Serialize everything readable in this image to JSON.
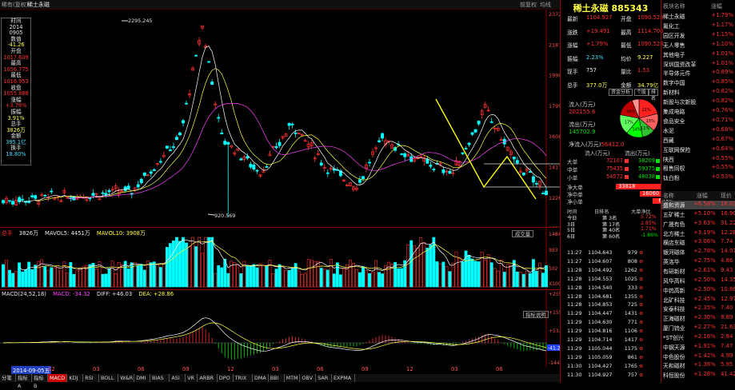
{
  "titlebar": {
    "left": "稀有(复权)",
    "stock": "稀土永磁",
    "right": "前复权",
    "indicator": "均线"
  },
  "infobox": [
    {
      "t": "时间",
      "c": "wht"
    },
    {
      "t": "2014",
      "c": "wht"
    },
    {
      "t": "0905",
      "c": "wht"
    },
    {
      "t": "数值",
      "c": "wht"
    },
    {
      "t": "-41.26",
      "c": "yel"
    },
    {
      "t": "开盘",
      "c": "wht"
    },
    {
      "t": "1017.609",
      "c": "red"
    },
    {
      "t": "最高",
      "c": "wht"
    },
    {
      "t": "1056.775",
      "c": "red"
    },
    {
      "t": "最低",
      "c": "wht"
    },
    {
      "t": "1016.953",
      "c": "red"
    },
    {
      "t": "收盘",
      "c": "wht"
    },
    {
      "t": "1055.888",
      "c": "red"
    },
    {
      "t": "涨幅",
      "c": "wht"
    },
    {
      "t": "+3.79%",
      "c": "red"
    },
    {
      "t": "振幅",
      "c": "wht"
    },
    {
      "t": "3.91%",
      "c": "yel"
    },
    {
      "t": "总手",
      "c": "wht"
    },
    {
      "t": "3826万",
      "c": "yel"
    },
    {
      "t": "金额",
      "c": "wht"
    },
    {
      "t": "395.1亿",
      "c": "cyn"
    },
    {
      "t": "换手",
      "c": "wht"
    },
    {
      "t": "18.80%",
      "c": "cyn"
    }
  ],
  "price_axis": [
    "2372",
    "2181",
    "1990",
    "1799",
    "1608",
    "1417",
    "1226",
    "1035"
  ],
  "annotations": {
    "high": "2295.245",
    "low": "920.569"
  },
  "volume": {
    "label": "总手",
    "total": "3826万",
    "ma5": "MAVOL5: 4451万",
    "ma10": "MAVOL10: 3908万",
    "axis": [
      "1484",
      "993",
      "502",
      "X100000"
    ],
    "btn": "成交量"
  },
  "macd": {
    "label": "MACD(24,52,18)",
    "macd": "MACD: -34.32",
    "diff": "DIFF: +46.03",
    "dea": "DEA: +28.86",
    "axis": [
      "+255.9",
      "+155.8",
      "+53.88",
      "-48.13",
      "-144.2"
    ],
    "badge": "-41.26",
    "btn": "指标说明"
  },
  "xaxis": [
    "2014-09-05五",
    "12",
    "03",
    "06",
    "09",
    "12",
    "03",
    "06",
    "09",
    "12",
    "03",
    "06"
  ],
  "tabs": [
    "分笔",
    "指标A",
    "指标B",
    "MACD",
    "KDJ",
    "RSI",
    "BOLL",
    "W&R",
    "DMI",
    "BIAS",
    "ASI",
    "VR",
    "ARBR",
    "DPO",
    "TRIX",
    "DMA",
    "BBI",
    "MTM",
    "OBV",
    "SAR",
    "EXPMA"
  ],
  "quote": {
    "title": "稀土永磁 885343",
    "rows": [
      {
        "l1": "最新",
        "v1": "1104.927",
        "c1": "red",
        "l2": "开盘",
        "v2": "1090.528",
        "c2": "red"
      },
      {
        "l1": "涨跌",
        "v1": "+19.491",
        "c1": "red",
        "l2": "最高",
        "v2": "1114.700",
        "c2": "red"
      },
      {
        "l1": "涨幅",
        "v1": "+1.79%",
        "c1": "red",
        "l2": "最低",
        "v2": "1090.528",
        "c2": "red"
      },
      {
        "l1": "振幅",
        "v1": "2.23%",
        "c1": "cyn",
        "l2": "均价",
        "v2": "9.227",
        "c2": "yel"
      },
      {
        "l1": "现手",
        "v1": "757",
        "c1": "wht",
        "l2": "量比",
        "v2": "1.53",
        "c2": "red"
      },
      {
        "l1": "总手",
        "v1": "377.0万",
        "c1": "yel",
        "l2": "金额",
        "v2": "34.79亿",
        "c2": "yel"
      }
    ],
    "btn_flow": "资金分析",
    "btn_up": "个股",
    "btn_rank": "排名",
    "inflow_label": "流入(万元)",
    "inflow": "202155.6",
    "outflow_label": "流出(万元)",
    "outflow": "145702.9",
    "pie": [
      {
        "v": 21,
        "c": "#ff2020"
      },
      {
        "v": 15,
        "c": "#ff6060"
      },
      {
        "v": 11,
        "c": "#30c030"
      },
      {
        "v": 14,
        "c": "#00ff00"
      },
      {
        "v": 17,
        "c": "#60ff60"
      },
      {
        "v": 16,
        "c": "#c00000"
      },
      {
        "v": 6,
        "c": "#ff9090"
      }
    ],
    "pie_labels": [
      "21%",
      "15%",
      "11%",
      "14%",
      "17%",
      "16%"
    ],
    "net_label": "净流入(万元)",
    "net": "56412.0",
    "flow_head": [
      "流入(万元)",
      "流出(万元)"
    ],
    "flow": [
      {
        "k": "大单",
        "in": "72107",
        "out": "38209"
      },
      {
        "k": "中单",
        "in": "75435",
        "out": "59375"
      },
      {
        "k": "小单",
        "in": "54572",
        "out": "48038"
      }
    ],
    "net_flow": [
      {
        "k": "净大单",
        "v": "33818",
        "w": 0.63
      },
      {
        "k": "净中单",
        "v": "16060",
        "w": 0.3
      },
      {
        "k": "净小单",
        "v": "6534",
        "w": 0.12
      }
    ],
    "hist_head": [
      "时间",
      "日排名",
      "大单净比"
    ],
    "hist": [
      {
        "t": "今日",
        "r": "第 3名",
        "v": "5.72%",
        "c": "red"
      },
      {
        "t": "3日",
        "r": "第 17名",
        "v": "2.85%",
        "c": "red"
      },
      {
        "t": "5日",
        "r": "第 40名",
        "v": "1.71%",
        "c": "red"
      },
      {
        "t": "6日",
        "r": "第 60名",
        "v": "-1.86%",
        "c": "grn"
      }
    ],
    "trades": [
      [
        "11:27",
        "1104.643",
        "979",
        "red"
      ],
      [
        "11:27",
        "1104.607",
        "808",
        "red"
      ],
      [
        "11:28",
        "1104.492",
        "1262",
        "red"
      ],
      [
        "11:28",
        "1104.553",
        "1025",
        "red"
      ],
      [
        "11:28",
        "1104.540",
        "333",
        "red"
      ],
      [
        "11:28",
        "1104.681",
        "1355",
        "red"
      ],
      [
        "11:28",
        "1104.853",
        "725",
        "red"
      ],
      [
        "11:29",
        "1104.447",
        "1431",
        "red"
      ],
      [
        "11:29",
        "1104.630",
        "771",
        "red"
      ],
      [
        "11:29",
        "1104.816",
        "1106",
        "red"
      ],
      [
        "11:29",
        "1104.714",
        "1417",
        "red"
      ],
      [
        "11:29",
        "1105.044",
        "1175",
        "red"
      ],
      [
        "11:29",
        "1105.059",
        "861",
        "red"
      ],
      [
        "11:30",
        "1104.427",
        "1765",
        "red"
      ],
      [
        "11:30",
        "1104.927",
        "757",
        "red"
      ]
    ]
  },
  "sectors_top": {
    "head": [
      "板块名称",
      "涨幅"
    ],
    "rows": [
      [
        "稀土永磁",
        "+1.79%"
      ],
      [
        "氟化工",
        "+1.17%"
      ],
      [
        "园区开发",
        "+1.15%"
      ],
      [
        "无人零售",
        "+1.10%"
      ],
      [
        "其他电子",
        "+1.01%"
      ],
      [
        "深圳国资改革",
        "+1.01%"
      ],
      [
        "半导体元件",
        "+0.89%"
      ],
      [
        "数字中国",
        "+0.85%"
      ],
      [
        "新材料",
        "+0.82%"
      ],
      [
        "新股与次新股",
        "+0.82%"
      ],
      [
        "集成电路",
        "+0.76%"
      ],
      [
        "食品安全",
        "+0.71%"
      ],
      [
        "水泥",
        "+0.68%"
      ],
      [
        "西藏",
        "+0.67%"
      ],
      [
        "互联网保险",
        "+0.64%"
      ],
      [
        "陕西",
        "+0.55%"
      ],
      [
        "租售同权",
        "+0.55%"
      ],
      [
        "钛白粉",
        "+0.53%"
      ]
    ]
  },
  "sectors_bottom": {
    "head": [
      "名称",
      "涨幅",
      "现价"
    ],
    "rows": [
      [
        "盛和资源",
        "+6.58%",
        "16.03"
      ],
      [
        "五矿稀土",
        "+5.10%",
        "16.90"
      ],
      [
        "广晟有色",
        "+3.63%",
        "31.22"
      ],
      [
        "北方稀土",
        "+3.19%",
        "12.28"
      ],
      [
        "横店东磁",
        "+3.06%",
        "7.74"
      ],
      [
        "银河磁体",
        "+2.78%",
        "14.07"
      ],
      [
        "英洛华",
        "+2.75%",
        "4.86"
      ],
      [
        "有研新材",
        "+2.61%",
        "9.43"
      ],
      [
        "风华高科",
        "+2.50%",
        "14.35"
      ],
      [
        "中钨高新",
        "+2.50%",
        "10.86"
      ],
      [
        "北矿科技",
        "+2.45%",
        "12.97"
      ],
      [
        "安泰科技",
        "+2.35%",
        "7.40"
      ],
      [
        "正海磁材",
        "+2.30%",
        "8.89"
      ],
      [
        "厦门钨业",
        "+2.27%",
        "21.63"
      ],
      [
        "*ST创兴",
        "+2.16%",
        "2.84"
      ],
      [
        "中钢天源",
        "+1.91%",
        "7.47"
      ],
      [
        "中色股份",
        "+1.42%",
        "4.99"
      ],
      [
        "天和磁材",
        "+1.36%",
        "5.95"
      ],
      [
        "科恒股份",
        "+1.28%",
        "41.42"
      ]
    ]
  },
  "colors": {
    "up": "#ff3030",
    "down": "#00ffff",
    "bg": "#000000",
    "frame": "#8b0000"
  }
}
